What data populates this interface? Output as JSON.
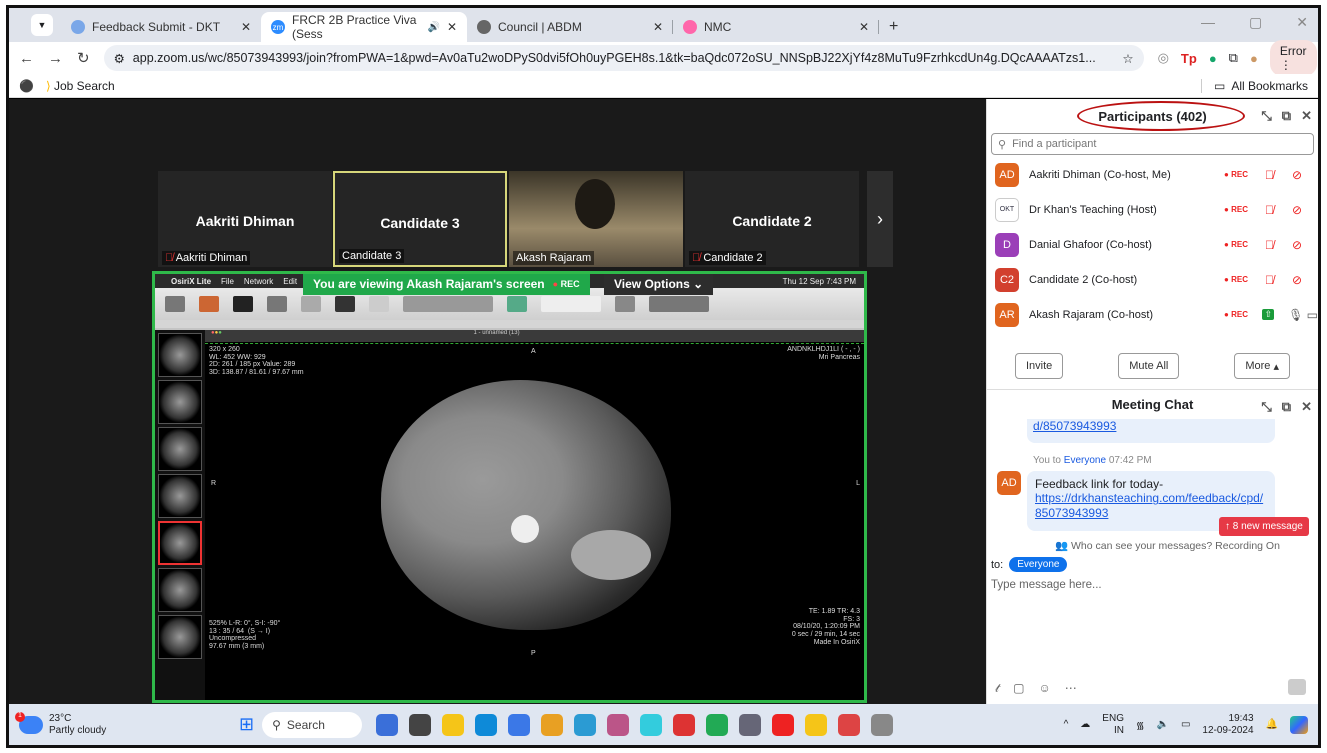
{
  "tabs": [
    {
      "title": "Feedback Submit - DKT",
      "color": "#7aa7e8"
    },
    {
      "title": "FRCR 2B Practice Viva (Sess",
      "color": "#2d8cff",
      "active": true
    },
    {
      "title": "Council | ABDM",
      "color": "#666"
    },
    {
      "title": "NMC",
      "color": "#f6a"
    }
  ],
  "address": {
    "url": "app.zoom.us/wc/85073943993/join?fromPWA=1&pwd=Av0aTu2woDPyS0dvi5fOh0uyPGEH8s.1&tk=baQdc072oSU_NNSpBJ22XjYf4z8MuTu9FzrhkcdUn4g.DQcAAAATzs1...",
    "error_label": "Error"
  },
  "bookmarks": {
    "job_search": "Job Search",
    "all_bookmarks": "All Bookmarks"
  },
  "gallery": {
    "tiles": [
      {
        "name": "Aakriti Dhiman",
        "label": "Aakriti Dhiman"
      },
      {
        "name": "Candidate 3",
        "label": "Candidate 3"
      },
      {
        "name": "",
        "label": "Akash Rajaram"
      },
      {
        "name": "Candidate 2",
        "label": "Candidate 2"
      }
    ]
  },
  "share": {
    "banner": "You are viewing  Akash Rajaram's screen",
    "rec": "REC",
    "view_options": "View Options",
    "menubar": [
      "OsiriX Lite",
      "File",
      "Network",
      "Edit"
    ],
    "clock": "Thu 12 Sep  7:43 PM",
    "series_title": "1 - unnamed (13)",
    "overlay_tl": "320 x 260\nWL: 452 WW: 929\n2D: 261 / 185 px Value: 289\n3D: 138.87 / 81.61 / 97.67 mm",
    "overlay_tr": "ANDNKLHDJ1LI ( - , - )\nMri Pancreas",
    "overlay_bl": "525% L-R: 0°, S-I: -90°\n13 : 35 / 64  (S → I)\nUncompressed\n97.67 mm (3 mm)",
    "overlay_br": "TE: 1.89 TR: 4.3\nFS: 3\n08/10/20, 1:20:09 PM\n0 sec / 29 min, 14 sec\nMade In OsiriX",
    "orient_top": "A",
    "orient_left": "R",
    "orient_right": "L",
    "orient_bottom": "P"
  },
  "participants": {
    "title": "Participants (402)",
    "search_placeholder": "Find a participant",
    "rec_label": "REC",
    "list": [
      {
        "initials": "AD",
        "name": "Aakriti Dhiman (Co-host, Me)",
        "color": "#e0651f"
      },
      {
        "initials": "OKT",
        "name": "Dr Khan's Teaching (Host)",
        "color": "#ffffff"
      },
      {
        "initials": "D",
        "name": "Danial Ghafoor (Co-host)",
        "color": "#9b3fb8"
      },
      {
        "initials": "C2",
        "name": "Candidate 2 (Co-host)",
        "color": "#d2402e"
      },
      {
        "initials": "AR",
        "name": "Akash Rajaram (Co-host)",
        "color": "#e0651f"
      }
    ],
    "invite": "Invite",
    "mute_all": "Mute All",
    "more": "More"
  },
  "chat": {
    "title": "Meeting Chat",
    "prev_tail": "d/85073943993",
    "meta_you": "You to",
    "meta_to": "Everyone",
    "meta_time": "07:42 PM",
    "sender_initials": "AD",
    "message_text": "Feedback link for today-",
    "message_link": "https://drkhansteaching.com/feedback/cpd/85073943993",
    "new_messages": "↑ 8 new message",
    "visibility": "Who can see your messages? Recording On",
    "to_label": "to:",
    "to_value": "Everyone",
    "input_placeholder": "Type message here..."
  },
  "taskbar": {
    "temp": "23°C",
    "weather": "Partly cloudy",
    "search": "Search",
    "lang": "ENG",
    "region": "IN",
    "time": "19:43",
    "date": "12-09-2024"
  }
}
